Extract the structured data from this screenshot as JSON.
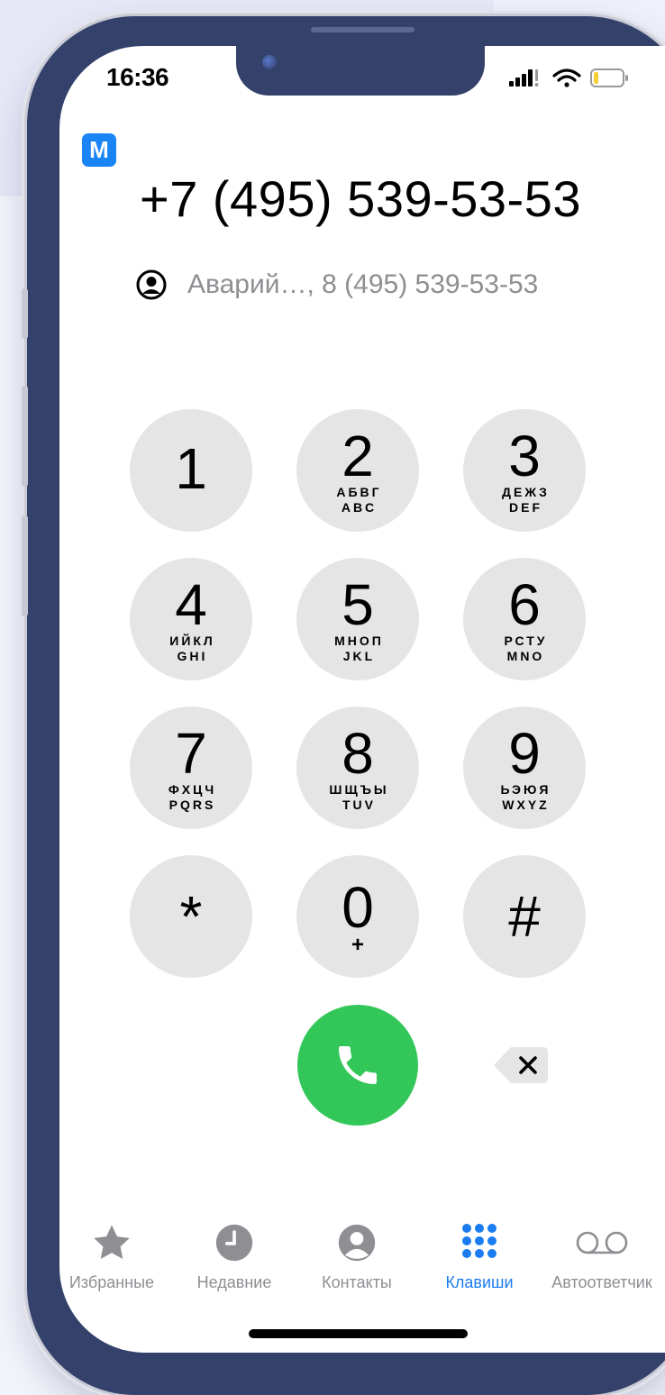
{
  "status": {
    "time": "16:36"
  },
  "carrier_badge": "M",
  "dialed_number": "+7 (495) 539-53-53",
  "suggestion": {
    "text": "Аварий…, 8 (495) 539-53-53"
  },
  "keypad": [
    {
      "digit": "1",
      "letters_ru": "",
      "letters_en": ""
    },
    {
      "digit": "2",
      "letters_ru": "АБВГ",
      "letters_en": "ABC"
    },
    {
      "digit": "3",
      "letters_ru": "ДЕЖЗ",
      "letters_en": "DEF"
    },
    {
      "digit": "4",
      "letters_ru": "ИЙКЛ",
      "letters_en": "GHI"
    },
    {
      "digit": "5",
      "letters_ru": "МНОП",
      "letters_en": "JKL"
    },
    {
      "digit": "6",
      "letters_ru": "РСТУ",
      "letters_en": "MNO"
    },
    {
      "digit": "7",
      "letters_ru": "ФХЦЧ",
      "letters_en": "PQRS"
    },
    {
      "digit": "8",
      "letters_ru": "ШЩЪЫ",
      "letters_en": "TUV"
    },
    {
      "digit": "9",
      "letters_ru": "ЬЭЮЯ",
      "letters_en": "WXYZ"
    },
    {
      "digit": "*",
      "letters_ru": "",
      "letters_en": ""
    },
    {
      "digit": "0",
      "letters_ru": "+",
      "letters_en": ""
    },
    {
      "digit": "#",
      "letters_ru": "",
      "letters_en": ""
    }
  ],
  "tabs": [
    {
      "label": "Избранные",
      "icon": "star-icon",
      "active": false
    },
    {
      "label": "Недавние",
      "icon": "clock-icon",
      "active": false
    },
    {
      "label": "Контакты",
      "icon": "person-icon",
      "active": false
    },
    {
      "label": "Клавиши",
      "icon": "keypad-icon",
      "active": true
    },
    {
      "label": "Автоответчик",
      "icon": "voicemail-icon",
      "active": false
    }
  ],
  "colors": {
    "call_green": "#33c759",
    "active_tab": "#1a7cf0",
    "inactive_tab": "#8e8e93",
    "key_fill": "#e5e5e5",
    "frame": "#34416a"
  }
}
